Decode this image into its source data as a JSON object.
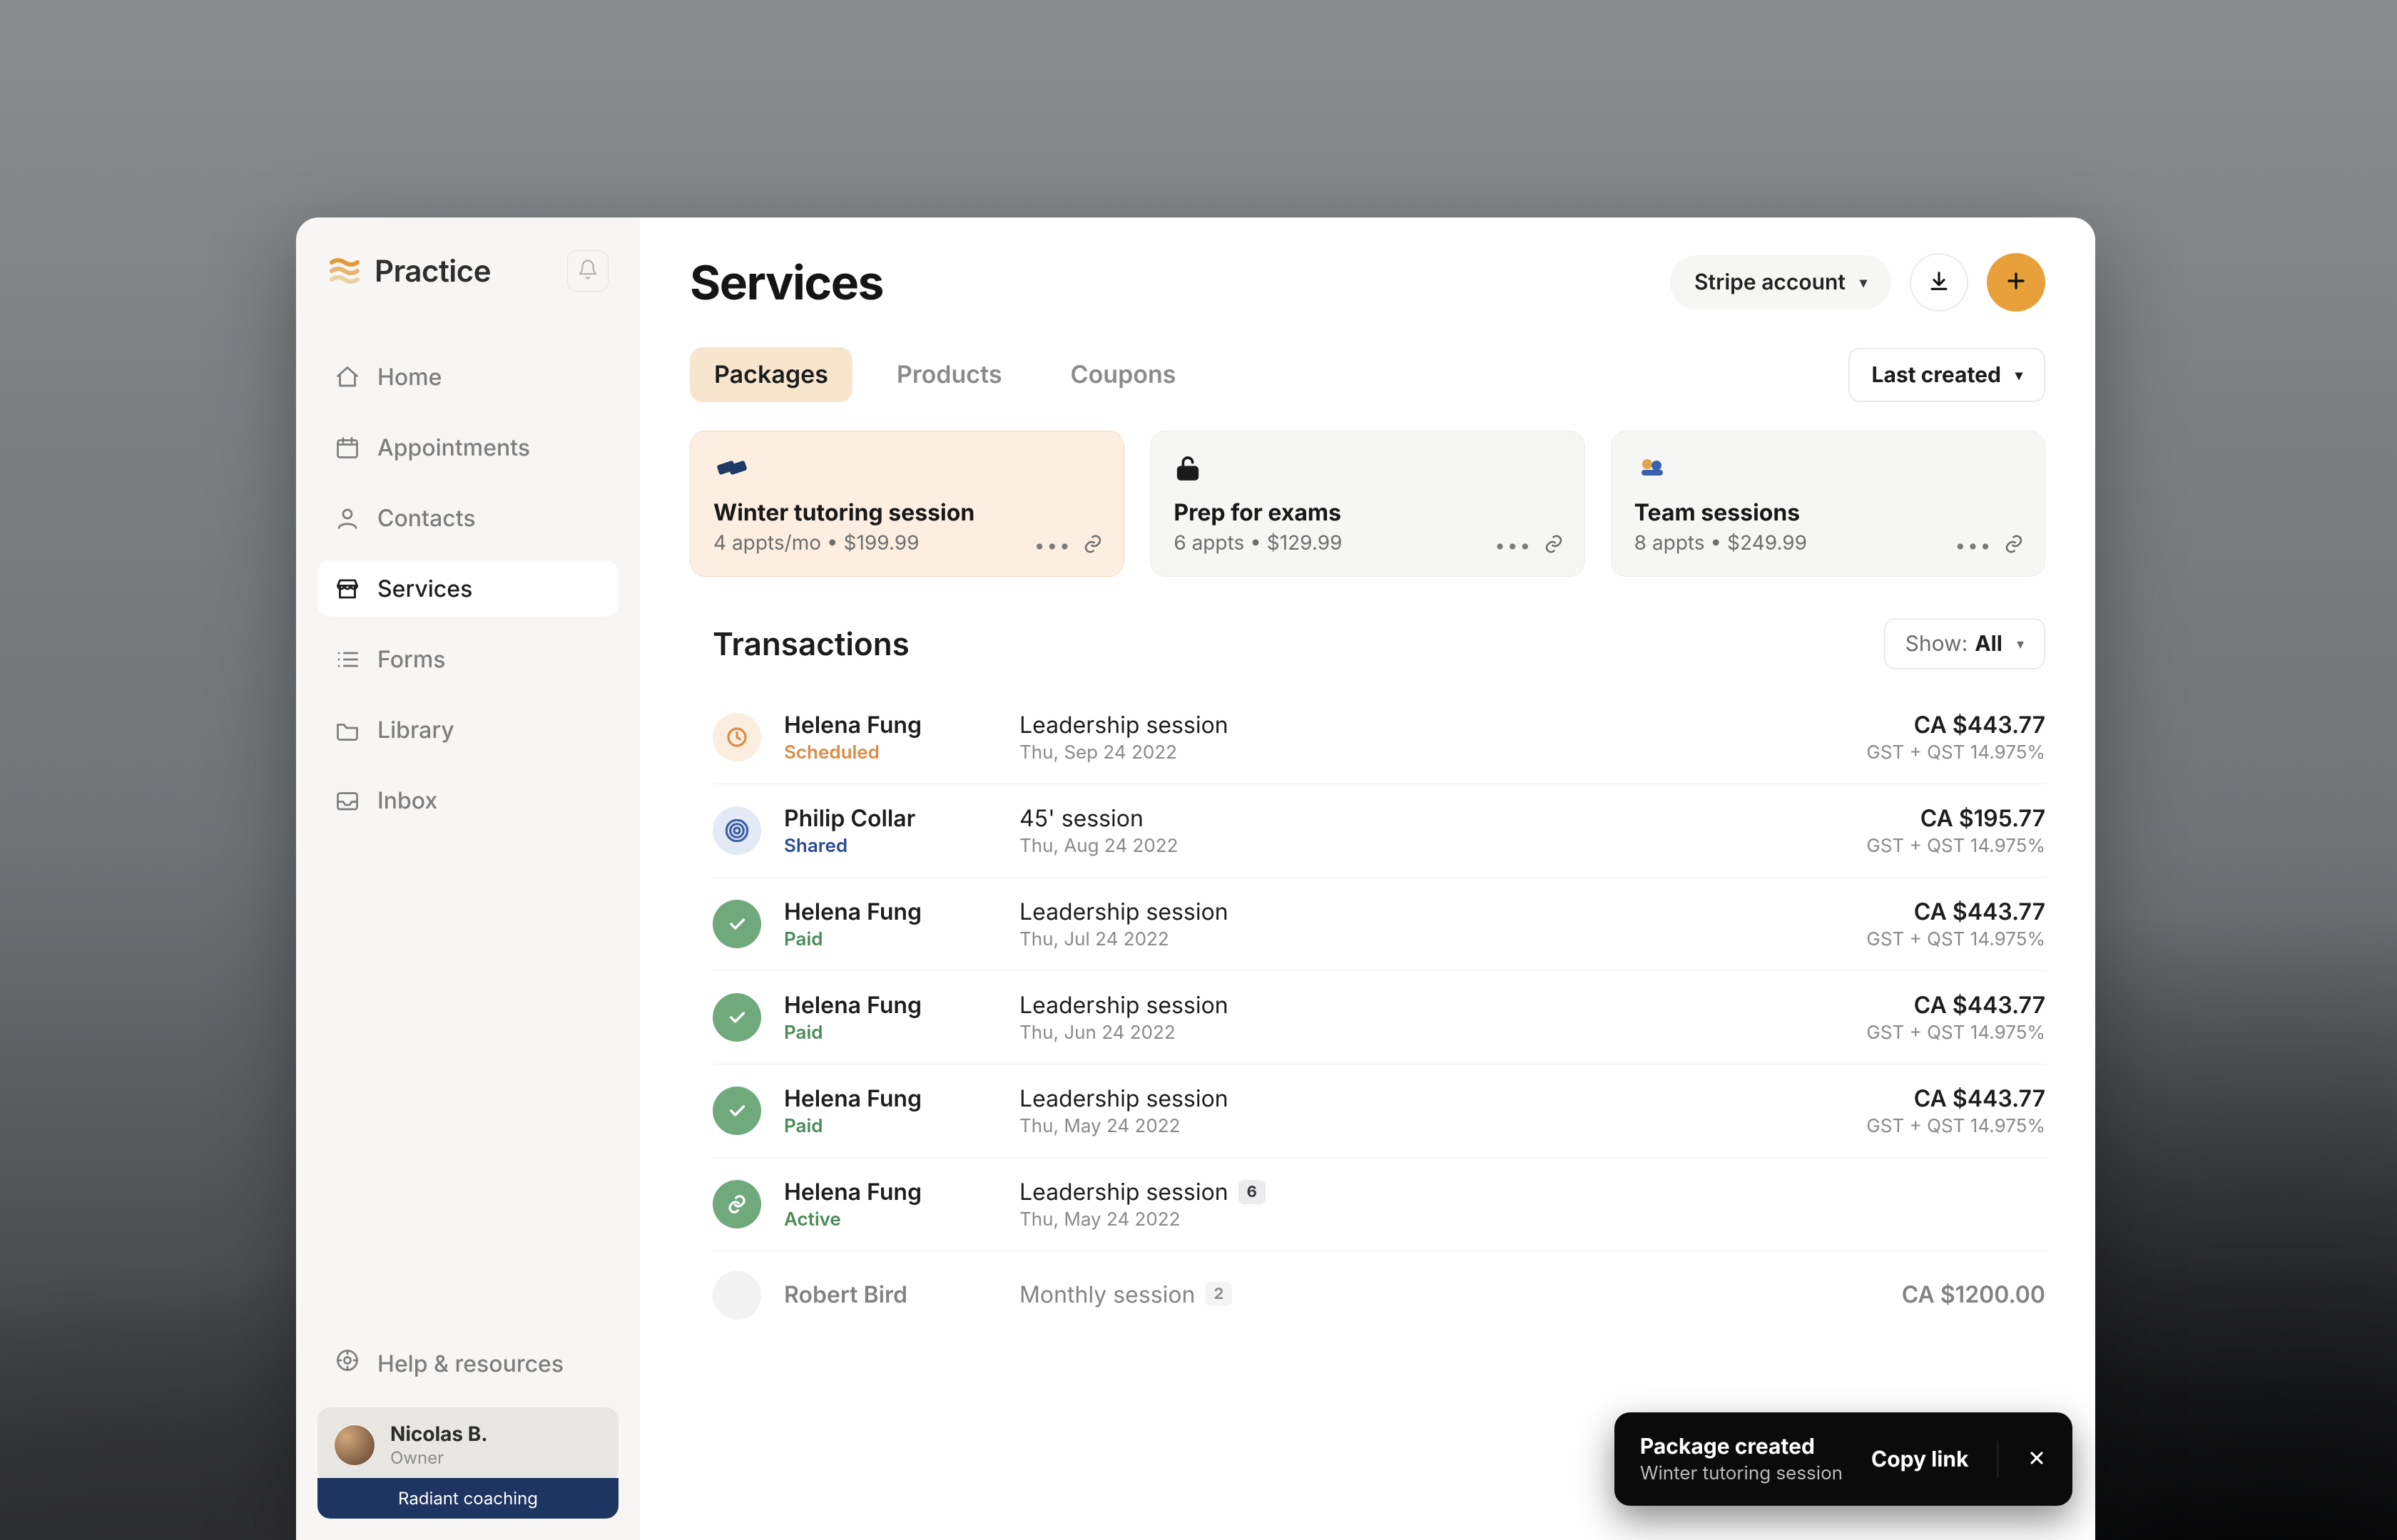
{
  "brand": {
    "name": "Practice"
  },
  "sidebar": {
    "items": [
      {
        "label": "Home"
      },
      {
        "label": "Appointments"
      },
      {
        "label": "Contacts"
      },
      {
        "label": "Services"
      },
      {
        "label": "Forms"
      },
      {
        "label": "Library"
      },
      {
        "label": "Inbox"
      }
    ],
    "help_label": "Help & resources"
  },
  "user": {
    "name": "Nicolas B.",
    "role": "Owner",
    "org": "Radiant coaching"
  },
  "page": {
    "title": "Services"
  },
  "header": {
    "stripe_label": "Stripe account"
  },
  "tabs": [
    {
      "label": "Packages"
    },
    {
      "label": "Products"
    },
    {
      "label": "Coupons"
    }
  ],
  "sort": {
    "label": "Last created"
  },
  "packages": [
    {
      "title": "Winter tutoring session",
      "sub": "4 appts/mo • $199.99"
    },
    {
      "title": "Prep for exams",
      "sub": "6 appts • $129.99"
    },
    {
      "title": "Team sessions",
      "sub": "8 appts • $249.99"
    }
  ],
  "transactions": {
    "title": "Transactions",
    "filter_prefix": "Show:",
    "filter_value": "All",
    "rows": [
      {
        "name": "Helena Fung",
        "status": "Scheduled",
        "status_key": "scheduled",
        "session": "Leadership session",
        "date": "Thu, Sep 24 2022",
        "amount": "CA $443.77",
        "tax": "GST + QST 14.975%"
      },
      {
        "name": "Philip Collar",
        "status": "Shared",
        "status_key": "shared",
        "session": "45' session",
        "date": "Thu, Aug 24 2022",
        "amount": "CA $195.77",
        "tax": "GST + QST 14.975%"
      },
      {
        "name": "Helena Fung",
        "status": "Paid",
        "status_key": "paid",
        "session": "Leadership session",
        "date": "Thu, Jul 24 2022",
        "amount": "CA $443.77",
        "tax": "GST + QST 14.975%"
      },
      {
        "name": "Helena Fung",
        "status": "Paid",
        "status_key": "paid",
        "session": "Leadership session",
        "date": "Thu, Jun 24 2022",
        "amount": "CA $443.77",
        "tax": "GST + QST 14.975%"
      },
      {
        "name": "Helena Fung",
        "status": "Paid",
        "status_key": "paid",
        "session": "Leadership session",
        "date": "Thu, May 24 2022",
        "amount": "CA $443.77",
        "tax": "GST + QST 14.975%"
      },
      {
        "name": "Helena Fung",
        "status": "Active",
        "status_key": "active",
        "session": "Leadership session",
        "badge": "6",
        "date": "Thu, May 24 2022",
        "amount": "",
        "tax": ""
      },
      {
        "name": "Robert Bird",
        "status": "",
        "status_key": "empty",
        "session": "Monthly session",
        "badge": "2",
        "date": "",
        "amount": "CA $1200.00",
        "tax": ""
      }
    ]
  },
  "toast": {
    "title": "Package created",
    "sub": "Winter tutoring session",
    "action": "Copy link"
  }
}
